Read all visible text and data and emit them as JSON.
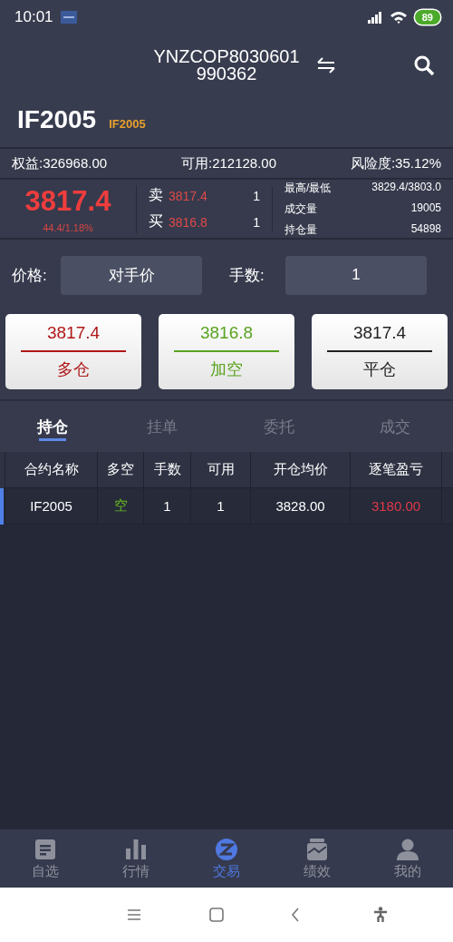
{
  "status_bar": {
    "time": "10:01",
    "battery": "89"
  },
  "header": {
    "account": "YNZCOP8030601 990362"
  },
  "contract": {
    "name": "IF2005",
    "code": "IF2005"
  },
  "account_bar": [
    {
      "text": "权益:326968.00"
    },
    {
      "text": "可用:212128.00"
    },
    {
      "text": "风险度:35.12%"
    }
  ],
  "quote": {
    "last": "3817.4",
    "change": "44.4/1.18%",
    "book": [
      {
        "side": "卖",
        "price": "3817.4",
        "qty": "1"
      },
      {
        "side": "买",
        "price": "3816.8",
        "qty": "1"
      }
    ],
    "stats": [
      {
        "label": "最高/最低",
        "value": "3829.4/3803.0"
      },
      {
        "label": "成交量",
        "value": "19005"
      },
      {
        "label": "持仓量",
        "value": "54898"
      }
    ]
  },
  "order": {
    "price_label": "价格:",
    "price": "对手价",
    "qty_label": "手数:",
    "qty": "1"
  },
  "actions": [
    {
      "price": "3817.4",
      "label": "多仓",
      "color": "#b01818"
    },
    {
      "price": "3816.8",
      "label": "加空",
      "color": "#58a320"
    },
    {
      "price": "3817.4",
      "label": "平仓",
      "color": "#222222"
    }
  ],
  "tabs": [
    {
      "label": "持仓",
      "selected": true
    },
    {
      "label": "挂单",
      "selected": false
    },
    {
      "label": "委托",
      "selected": false
    },
    {
      "label": "成交",
      "selected": false
    }
  ],
  "table": {
    "columns": [
      "合约名称",
      "多空",
      "手数",
      "可用",
      "开仓均价",
      "逐笔盈亏"
    ],
    "rows": [
      {
        "selected": true,
        "cells": [
          {
            "text": "IF2005"
          },
          {
            "text": "空",
            "color": "#6ab822"
          },
          {
            "text": "1"
          },
          {
            "text": "1"
          },
          {
            "text": "3828.00"
          },
          {
            "text": "3180.00",
            "color": "#e0394a"
          }
        ]
      }
    ]
  },
  "bottom_nav": [
    {
      "label": "自选",
      "selected": false
    },
    {
      "label": "行情",
      "selected": false
    },
    {
      "label": "交易",
      "selected": true
    },
    {
      "label": "绩效",
      "selected": false
    },
    {
      "label": "我的",
      "selected": false
    }
  ]
}
